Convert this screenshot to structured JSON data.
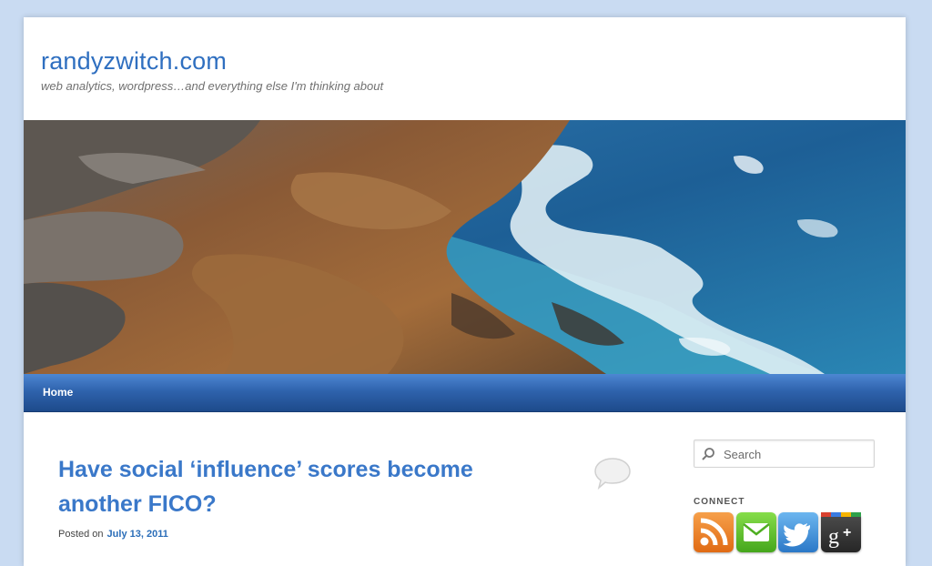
{
  "site": {
    "title": "randyzwitch.com",
    "description": "web analytics, wordpress…and everything else I'm thinking about"
  },
  "nav": {
    "items": [
      {
        "label": "Home"
      }
    ]
  },
  "post": {
    "title": "Have social ‘influence’ scores become another FICO?",
    "posted_label": "Posted on",
    "date": "July 13, 2011"
  },
  "sidebar": {
    "search": {
      "placeholder": "Search",
      "value": ""
    },
    "connect_label": "CONNECT",
    "social_icons": [
      "rss-icon",
      "email-icon",
      "twitter-icon",
      "google-plus-icon"
    ]
  },
  "colors": {
    "page_background": "#c9dbf2",
    "title_blue": "#2f6fc0",
    "nav_blue": "#2f63ad",
    "rss_orange": "#e8781e",
    "email_green": "#5cbf2a",
    "twitter_blue": "#3d8fd6",
    "gplus_dark": "#3a3a3a"
  }
}
